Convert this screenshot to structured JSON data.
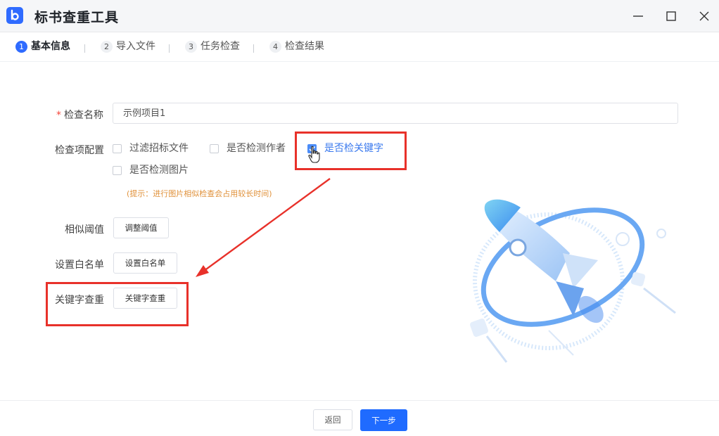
{
  "window": {
    "title": "标书查重工具",
    "icons": [
      "app-logo-icon",
      "minimize-icon",
      "maximize-icon",
      "close-icon"
    ]
  },
  "steps": [
    {
      "num": "1",
      "label": "基本信息",
      "active": true
    },
    {
      "num": "2",
      "label": "导入文件",
      "active": false
    },
    {
      "num": "3",
      "label": "任务检查",
      "active": false
    },
    {
      "num": "4",
      "label": "检查结果",
      "active": false
    }
  ],
  "form": {
    "name_label": "检查名称",
    "required_mark": "*",
    "name_value": "示例项目1",
    "config_label": "检查项配置",
    "checkboxes": [
      {
        "label": "过滤招标文件",
        "checked": false
      },
      {
        "label": "是否检测作者",
        "checked": false
      },
      {
        "label": "是否检关键字",
        "checked": true
      },
      {
        "label": "是否检测图片",
        "checked": false
      }
    ],
    "hint": "(提示：进行图片相似检查会占用较长时间)",
    "similarity_label": "相似阈值",
    "similarity_button": "调整阈值",
    "whitelist_label": "设置白名单",
    "whitelist_button": "设置白名单",
    "keyword_label": "关键字查重",
    "keyword_button": "关键字查重"
  },
  "footer": {
    "back_label": "返回",
    "next_label": "下一步"
  },
  "colors": {
    "accent": "#1f6bff",
    "annotation": "#e8312a",
    "hint": "#e0913a"
  }
}
